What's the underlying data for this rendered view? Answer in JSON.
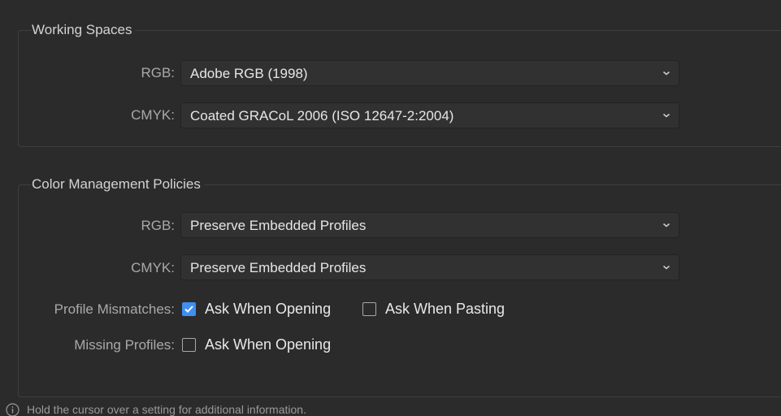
{
  "working_spaces": {
    "title": "Working Spaces",
    "rgb": {
      "label": "RGB:",
      "value": "Adobe RGB (1998)"
    },
    "cmyk": {
      "label": "CMYK:",
      "value": "Coated GRACoL 2006 (ISO 12647-2:2004)"
    }
  },
  "policies": {
    "title": "Color Management Policies",
    "rgb": {
      "label": "RGB:",
      "value": "Preserve Embedded Profiles"
    },
    "cmyk": {
      "label": "CMYK:",
      "value": "Preserve Embedded Profiles"
    },
    "profile_mismatches": {
      "label": "Profile Mismatches:",
      "ask_when_opening": {
        "label": "Ask When Opening",
        "checked": true
      },
      "ask_when_pasting": {
        "label": "Ask When Pasting",
        "checked": false
      }
    },
    "missing_profiles": {
      "label": "Missing Profiles:",
      "ask_when_opening": {
        "label": "Ask When Opening",
        "checked": false
      }
    }
  },
  "footer": {
    "icon": "info-icon",
    "text": "Hold the cursor over a setting for additional information."
  },
  "colors": {
    "background": "#2b2b2b",
    "checkbox_accent": "#3f8ef0"
  }
}
